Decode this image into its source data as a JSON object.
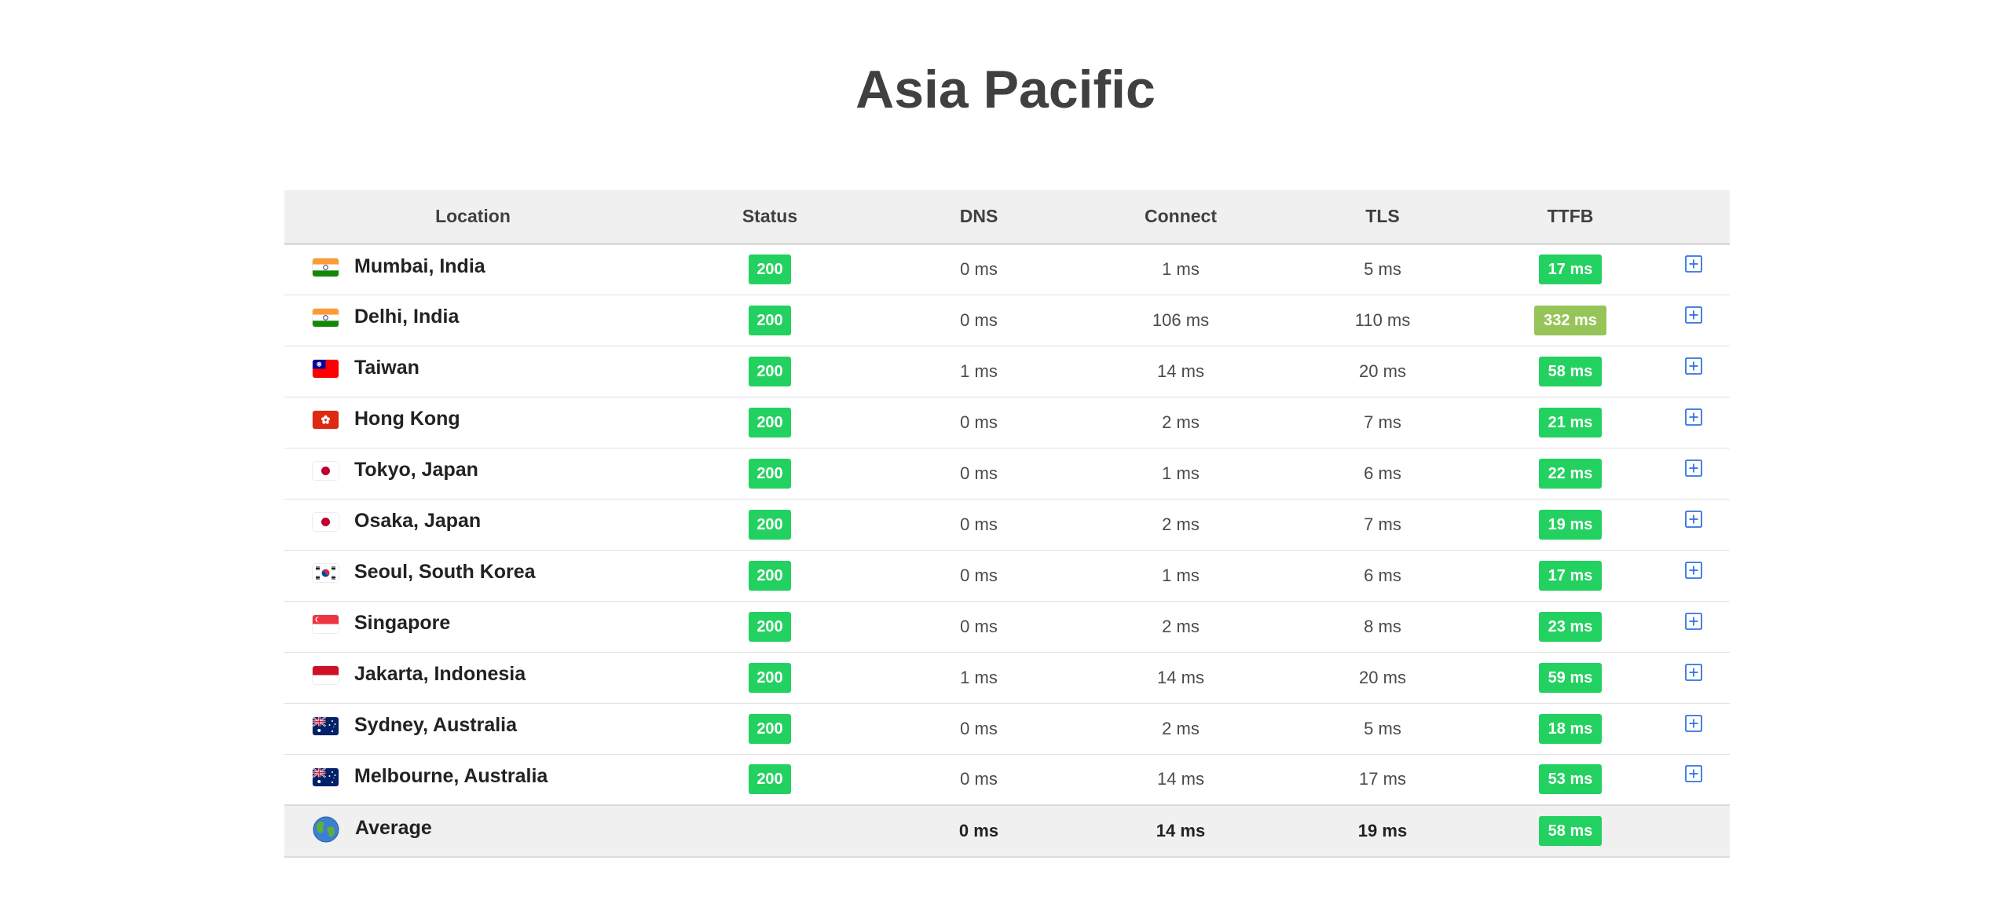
{
  "title": "Asia Pacific",
  "columns": {
    "location": "Location",
    "status": "Status",
    "dns": "DNS",
    "connect": "Connect",
    "tls": "TLS",
    "ttfb": "TTFB"
  },
  "colors": {
    "fast": "#23d160",
    "slow": "#97c459",
    "expand": "#3273dc"
  },
  "rows": [
    {
      "flag": "india-flag-icon",
      "location": "Mumbai, India",
      "status": "200",
      "dns": "0 ms",
      "connect": "1 ms",
      "tls": "5 ms",
      "ttfb": "17 ms",
      "ttfb_level": "fast"
    },
    {
      "flag": "india-flag-icon",
      "location": "Delhi, India",
      "status": "200",
      "dns": "0 ms",
      "connect": "106 ms",
      "tls": "110 ms",
      "ttfb": "332 ms",
      "ttfb_level": "slow"
    },
    {
      "flag": "taiwan-flag-icon",
      "location": "Taiwan",
      "status": "200",
      "dns": "1 ms",
      "connect": "14 ms",
      "tls": "20 ms",
      "ttfb": "58 ms",
      "ttfb_level": "fast"
    },
    {
      "flag": "hong-kong-flag-icon",
      "location": "Hong Kong",
      "status": "200",
      "dns": "0 ms",
      "connect": "2 ms",
      "tls": "7 ms",
      "ttfb": "21 ms",
      "ttfb_level": "fast"
    },
    {
      "flag": "japan-flag-icon",
      "location": "Tokyo, Japan",
      "status": "200",
      "dns": "0 ms",
      "connect": "1 ms",
      "tls": "6 ms",
      "ttfb": "22 ms",
      "ttfb_level": "fast"
    },
    {
      "flag": "japan-flag-icon",
      "location": "Osaka, Japan",
      "status": "200",
      "dns": "0 ms",
      "connect": "2 ms",
      "tls": "7 ms",
      "ttfb": "19 ms",
      "ttfb_level": "fast"
    },
    {
      "flag": "south-korea-flag-icon",
      "location": "Seoul, South Korea",
      "status": "200",
      "dns": "0 ms",
      "connect": "1 ms",
      "tls": "6 ms",
      "ttfb": "17 ms",
      "ttfb_level": "fast"
    },
    {
      "flag": "singapore-flag-icon",
      "location": "Singapore",
      "status": "200",
      "dns": "0 ms",
      "connect": "2 ms",
      "tls": "8 ms",
      "ttfb": "23 ms",
      "ttfb_level": "fast"
    },
    {
      "flag": "indonesia-flag-icon",
      "location": "Jakarta, Indonesia",
      "status": "200",
      "dns": "1 ms",
      "connect": "14 ms",
      "tls": "20 ms",
      "ttfb": "59 ms",
      "ttfb_level": "fast"
    },
    {
      "flag": "australia-flag-icon",
      "location": "Sydney, Australia",
      "status": "200",
      "dns": "0 ms",
      "connect": "2 ms",
      "tls": "5 ms",
      "ttfb": "18 ms",
      "ttfb_level": "fast"
    },
    {
      "flag": "australia-flag-icon",
      "location": "Melbourne, Australia",
      "status": "200",
      "dns": "0 ms",
      "connect": "14 ms",
      "tls": "17 ms",
      "ttfb": "53 ms",
      "ttfb_level": "fast"
    }
  ],
  "average": {
    "icon": "globe-icon",
    "label": "Average",
    "dns": "0 ms",
    "connect": "14 ms",
    "tls": "19 ms",
    "ttfb": "58 ms"
  }
}
